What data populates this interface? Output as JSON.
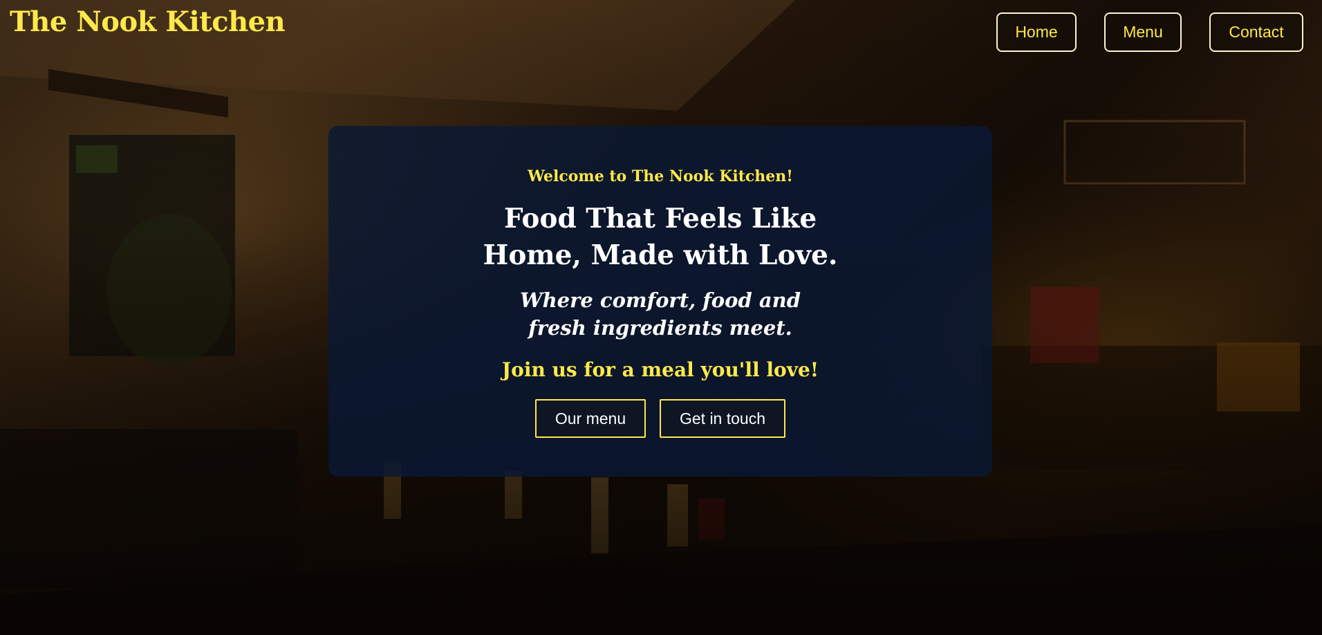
{
  "header": {
    "brand": "The Nook Kitchen",
    "nav": {
      "home": "Home",
      "menu": "Menu",
      "contact": "Contact"
    }
  },
  "hero": {
    "welcome": "Welcome to The Nook Kitchen!",
    "headline": "Food That Feels Like Home, Made with Love.",
    "tagline": "Where comfort, food and fresh ingredients meet.",
    "invite": "Join us for a meal you'll love!",
    "buttons": {
      "menu": "Our menu",
      "contact": "Get in touch"
    }
  },
  "colors": {
    "accent": "#ffe94a",
    "hero_panel": "#0a1834",
    "text_light": "#ffffff"
  },
  "background": {
    "icon": "restaurant-interior-photo"
  }
}
